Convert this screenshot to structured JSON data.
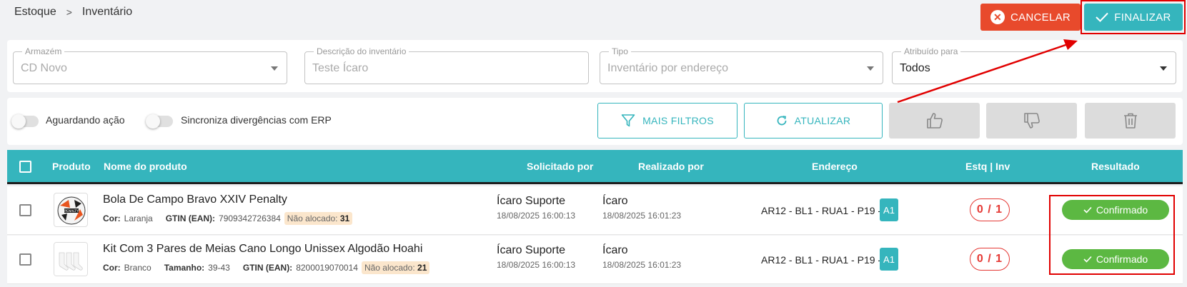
{
  "breadcrumb": {
    "items": [
      "Estoque",
      "Inventário"
    ],
    "separator": ">"
  },
  "actions": {
    "cancel_label": "CANCELAR",
    "finalize_label": "FINALIZAR"
  },
  "filters": {
    "warehouse": {
      "label": "Armazém",
      "value": "CD Novo"
    },
    "description": {
      "label": "Descrição do inventário",
      "value": "Teste Ícaro"
    },
    "type": {
      "label": "Tipo",
      "value": "Inventário por endereço"
    },
    "assigned": {
      "label": "Atribuído para",
      "value": "Todos"
    }
  },
  "toolbar": {
    "toggle_waiting": "Aguardando ação",
    "toggle_sync": "Sincroniza divergências com ERP",
    "more_filters": "MAIS FILTROS",
    "refresh": "ATUALIZAR"
  },
  "table": {
    "headers": {
      "product": "Produto",
      "product_name": "Nome do produto",
      "requested_by": "Solicitado por",
      "performed_by": "Realizado por",
      "address": "Endereço",
      "stock_inv": "Estq | Inv",
      "result": "Resultado"
    },
    "rows": [
      {
        "name": "Bola De Campo Bravo XXIV Penalty",
        "color_label": "Cor:",
        "color": "Laranja",
        "size_label": "",
        "size": "",
        "gtin_label": "GTIN (EAN):",
        "gtin": "7909342726384",
        "unallocated_label": "Não alocado:",
        "unallocated": "31",
        "requested_by": "Ícaro Suporte",
        "requested_at": "18/08/2025 16:00:13",
        "performed_by": "Ícaro",
        "performed_at": "18/08/2025 16:01:23",
        "address": "AR12 - BL1 - RUA1 - P19 -",
        "address_tag": "A1",
        "qty": "0 / 1",
        "result": "Confirmado",
        "thumb_icon": "soccer-ball-icon"
      },
      {
        "name": "Kit Com 3 Pares de Meias Cano Longo Unissex Algodão Hoahi",
        "color_label": "Cor:",
        "color": "Branco",
        "size_label": "Tamanho:",
        "size": "39-43",
        "gtin_label": "GTIN (EAN):",
        "gtin": "8200019070014",
        "unallocated_label": "Não alocado:",
        "unallocated": "21",
        "requested_by": "Ícaro Suporte",
        "requested_at": "18/08/2025 16:00:13",
        "performed_by": "Ícaro",
        "performed_at": "18/08/2025 16:01:23",
        "address": "AR12 - BL1 - RUA1 - P19 -",
        "address_tag": "A1",
        "qty": "0 / 1",
        "result": "Confirmado",
        "thumb_icon": "socks-icon"
      }
    ]
  },
  "colors": {
    "accent": "#35b5bd",
    "danger": "#e84a2c",
    "success": "#5cb842",
    "highlight": "#e10000"
  }
}
